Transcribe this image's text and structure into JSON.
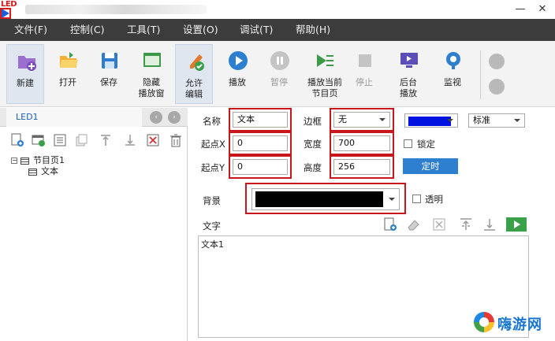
{
  "window": {
    "minimize_glyph": "—",
    "close_glyph": "✕",
    "logo_text": "LED"
  },
  "menu": {
    "items": [
      {
        "label": "文件(F)"
      },
      {
        "label": "控制(C)"
      },
      {
        "label": "工具(T)"
      },
      {
        "label": "设置(O)"
      },
      {
        "label": "调试(T)"
      },
      {
        "label": "帮助(H)"
      }
    ]
  },
  "toolbar": {
    "new": "新建",
    "open": "打开",
    "save": "保存",
    "hide": "隐藏\n播放窗",
    "allow_edit": "允许\n编辑",
    "play": "播放",
    "pause": "暂停",
    "play_current": "播放当前\n节目页",
    "stop": "停止",
    "background_play": "后台\n播放",
    "monitor": "监视"
  },
  "left": {
    "tab": "LED1",
    "nav_prev": "‹",
    "nav_next": "›",
    "tree": {
      "toggle": "−",
      "page": "节目页1",
      "child": "文本"
    }
  },
  "props": {
    "name_label": "名称",
    "name_value": "文本",
    "border_label": "边框",
    "border_value": "无",
    "x_label": "起点X",
    "x_value": "0",
    "width_label": "宽度",
    "width_value": "700",
    "lock_label": "锁定",
    "y_label": "起点Y",
    "y_value": "0",
    "height_label": "高度",
    "height_value": "256",
    "timer_button": "定时",
    "style_value": "标准",
    "border_color": "#0012e0",
    "background_label": "背景",
    "background_color": "#000000",
    "transparent_label": "透明",
    "text_label": "文字",
    "text_content": "文本1"
  },
  "watermark": {
    "text": "嗨游网"
  }
}
